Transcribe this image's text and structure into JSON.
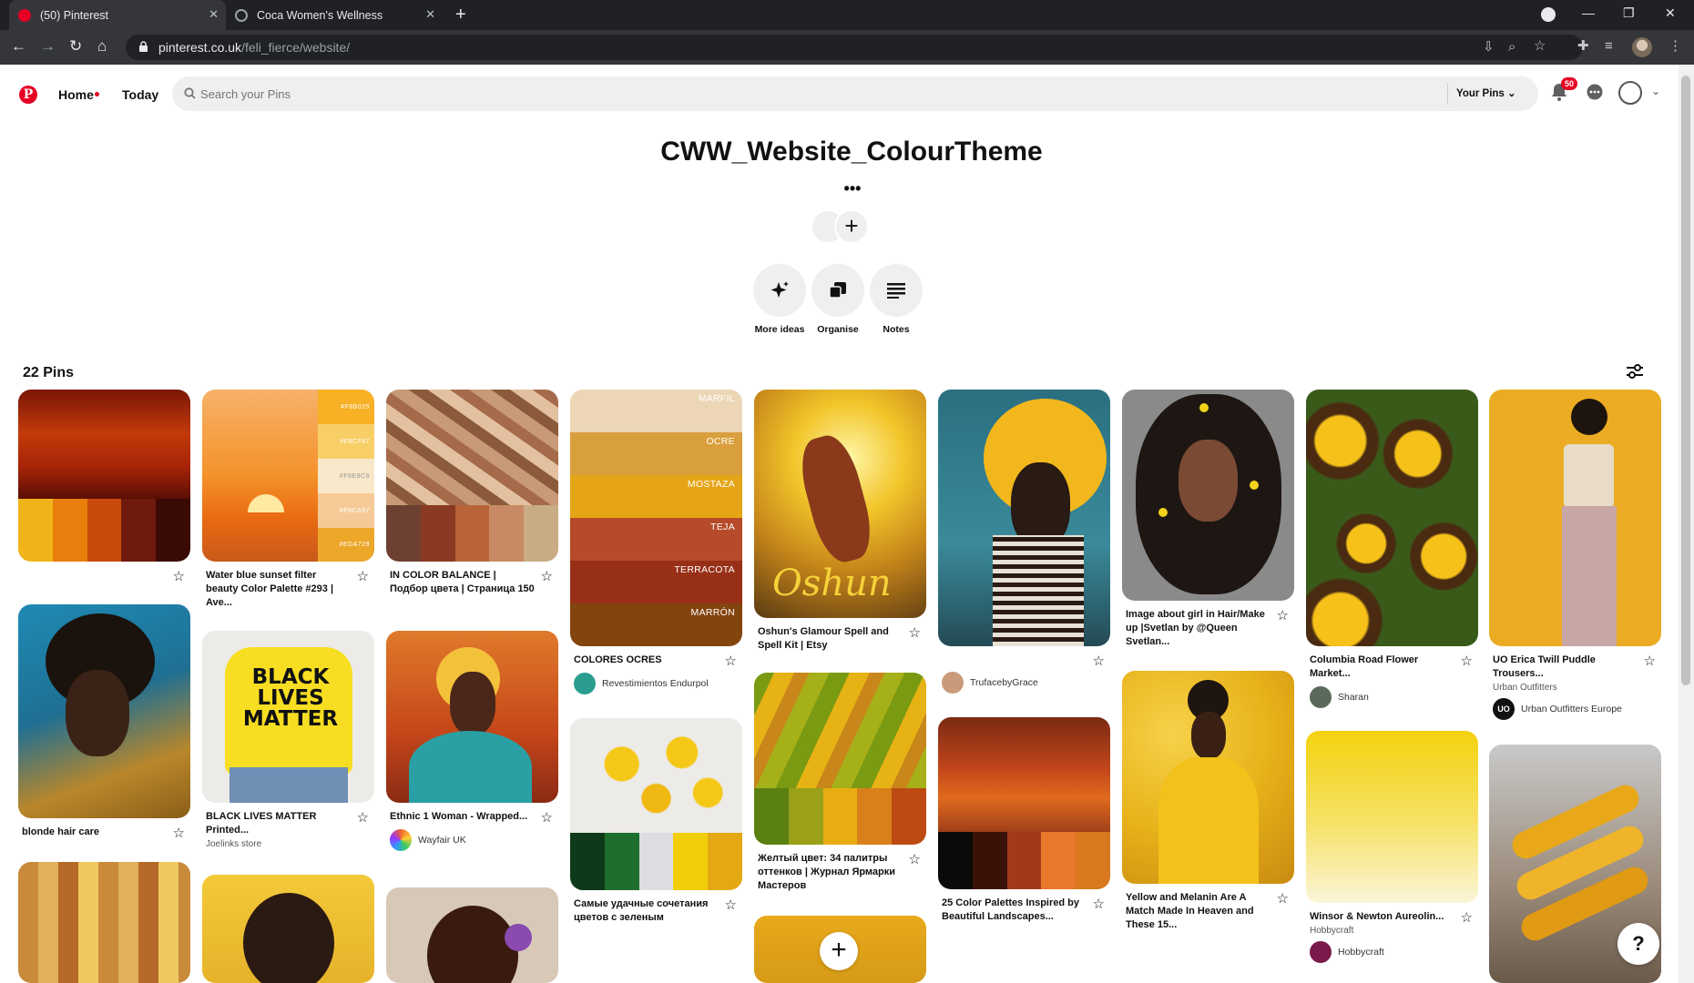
{
  "browser": {
    "tabs": [
      {
        "title": "(50) Pinterest",
        "active": true
      },
      {
        "title": "Coca Women's Wellness",
        "active": false
      }
    ],
    "url_domain": "pinterest.co.uk",
    "url_path": "/feli_fierce/website/"
  },
  "header": {
    "nav": {
      "home": "Home",
      "today": "Today"
    },
    "search_placeholder": "Search your Pins",
    "your_pins": "Your Pins",
    "notification_count": "50"
  },
  "board": {
    "title": "CWW_Website_ColourTheme",
    "more": "•••",
    "actions": [
      {
        "label": "More ideas",
        "icon": "sparkle-icon"
      },
      {
        "label": "Organise",
        "icon": "organise-icon"
      },
      {
        "label": "Notes",
        "icon": "notes-icon"
      }
    ],
    "pin_count": "22 Pins"
  },
  "pins": [
    {
      "title": "",
      "owner": ""
    },
    {
      "title": "Water blue sunset filter beauty Color Palette #293 | Ave..."
    },
    {
      "title": "IN COLOR BALANCE | Подбор цвета | Страница 150"
    },
    {
      "title": "COLORES OCRES",
      "owner": "Revestimientos Endurpol",
      "bands": [
        "MARFIL",
        "OCRE",
        "MOSTAZA",
        "TEJA",
        "TERRACOTA",
        "MARRÓN"
      ]
    },
    {
      "title": "Oshun's Glamour Spell and Spell Kit | Etsy",
      "overlay": "Oshun"
    },
    {
      "title": "",
      "owner": "TrufacebyGrace"
    },
    {
      "title": "Image about girl in Hair/Make up |Svetlan by @Queen Svetlan..."
    },
    {
      "title": "Columbia Road Flower Market...",
      "owner": "Sharan"
    },
    {
      "title": "UO Erica Twill Puddle Trousers...",
      "sub": "Urban Outfitters",
      "owner": "Urban Outfitters Europe"
    },
    {
      "title": "blonde hair care"
    },
    {
      "title": "BLACK LIVES MATTER Printed...",
      "sub": "Joelinks store",
      "shirt": "BLACK LIVES MATTER"
    },
    {
      "title": "Ethnic 1 Woman - Wrapped...",
      "owner": "Wayfair UK"
    },
    {
      "title": "Самые удачные сочетания цветов с зеленым"
    },
    {
      "title": "Желтый цвет: 34 палитры оттенков | Журнал Ярмарки Мастеров"
    },
    {
      "title": "25 Color Palettes Inspired by Beautiful Landscapes..."
    },
    {
      "title": "Yellow and Melanin Are A Match Made In Heaven and These 15..."
    },
    {
      "title": "Winsor & Newton Aureolin...",
      "sub": "Hobbycraft",
      "owner": "Hobbycraft"
    }
  ],
  "palette_hex": [
    "#F8B025",
    "#F8CF67",
    "#F8E8C9",
    "#F6CA97",
    "#EDA729"
  ],
  "colors": {
    "brand": "#e60023"
  }
}
